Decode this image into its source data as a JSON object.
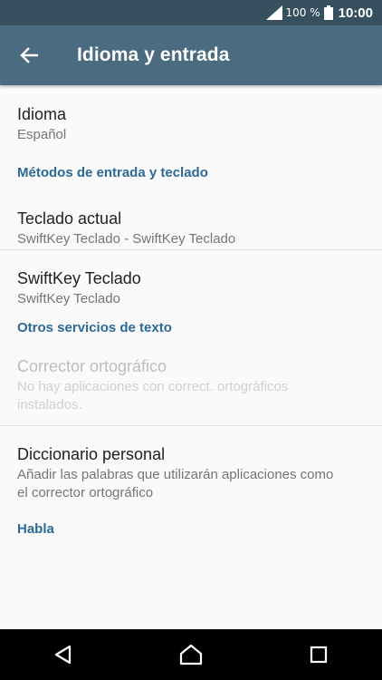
{
  "status_bar": {
    "battery_percent": "100 %",
    "time": "10:00"
  },
  "app_bar": {
    "title": "Idioma y entrada"
  },
  "settings": {
    "language": {
      "title": "Idioma",
      "summary": "Español"
    },
    "category_input": "Métodos de entrada y teclado",
    "current_keyboard": {
      "title": "Teclado actual",
      "summary": "SwiftKey Teclado - SwiftKey Teclado"
    },
    "swiftkey": {
      "title": "SwiftKey Teclado",
      "summary": "SwiftKey Teclado"
    },
    "category_text": "Otros servicios de texto",
    "spell_checker": {
      "title": "Corrector ortográfico",
      "summary_line1": "No hay aplicaciones con correct. ortográficos",
      "summary_line2": "instalados."
    },
    "personal_dictionary": {
      "title": "Diccionario personal",
      "summary_line1": "Añadir las palabras que utilizarán aplicaciones como",
      "summary_line2": "el corrector ortográfico"
    },
    "category_speech": "Habla"
  },
  "colors": {
    "status_bar": "#37505f",
    "app_bar": "#4b6b80",
    "category_accent": "#2b6a96",
    "background": "#fafafa",
    "nav_bar": "#000000"
  },
  "icons": {
    "back": "arrow-left-icon",
    "signal": "signal-icon",
    "battery": "battery-icon",
    "nav_back": "triangle-back-icon",
    "nav_home": "circle-home-icon",
    "nav_recents": "square-recents-icon"
  }
}
